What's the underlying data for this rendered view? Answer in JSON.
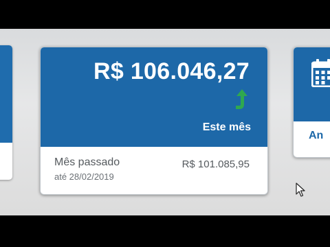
{
  "main_card": {
    "amount": "R$ 106.046,27",
    "period_label": "Este mês",
    "trend_icon": "arrow-up-icon",
    "previous": {
      "label": "Mês passado",
      "date": "até 28/02/2019",
      "value": "R$ 101.085,95"
    }
  },
  "right_card": {
    "label": "An",
    "icon": "calendar-icon"
  },
  "colors": {
    "card_blue": "#1d68a8",
    "trend_green": "#2fa84f",
    "secondary_text": "#555a5e"
  }
}
